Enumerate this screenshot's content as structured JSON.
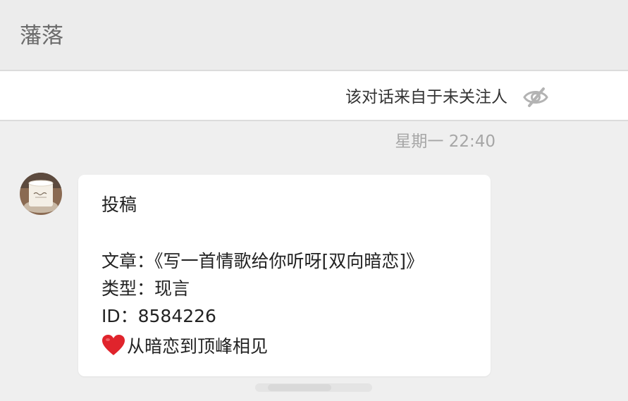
{
  "header": {
    "title": "藩落"
  },
  "notice": {
    "text": "该对话来自于未关注人",
    "icon": "eye-slash-icon"
  },
  "conversation": {
    "timestamp": "星期一 22:40",
    "message": {
      "line_1": "投稿",
      "line_2": "文章：《写一首情歌给你听呀[双向暗恋]》",
      "line_3": "类型：现言",
      "line_4": "ID：8584226",
      "line_5": "从暗恋到顶峰相见",
      "line_5_icon": "heart-icon"
    }
  },
  "colors": {
    "page_background": "#efefef",
    "header_background": "#ececec",
    "bubble_background": "#ffffff",
    "heart": "#e0242c",
    "timestamp_text": "#a6a6a6"
  }
}
